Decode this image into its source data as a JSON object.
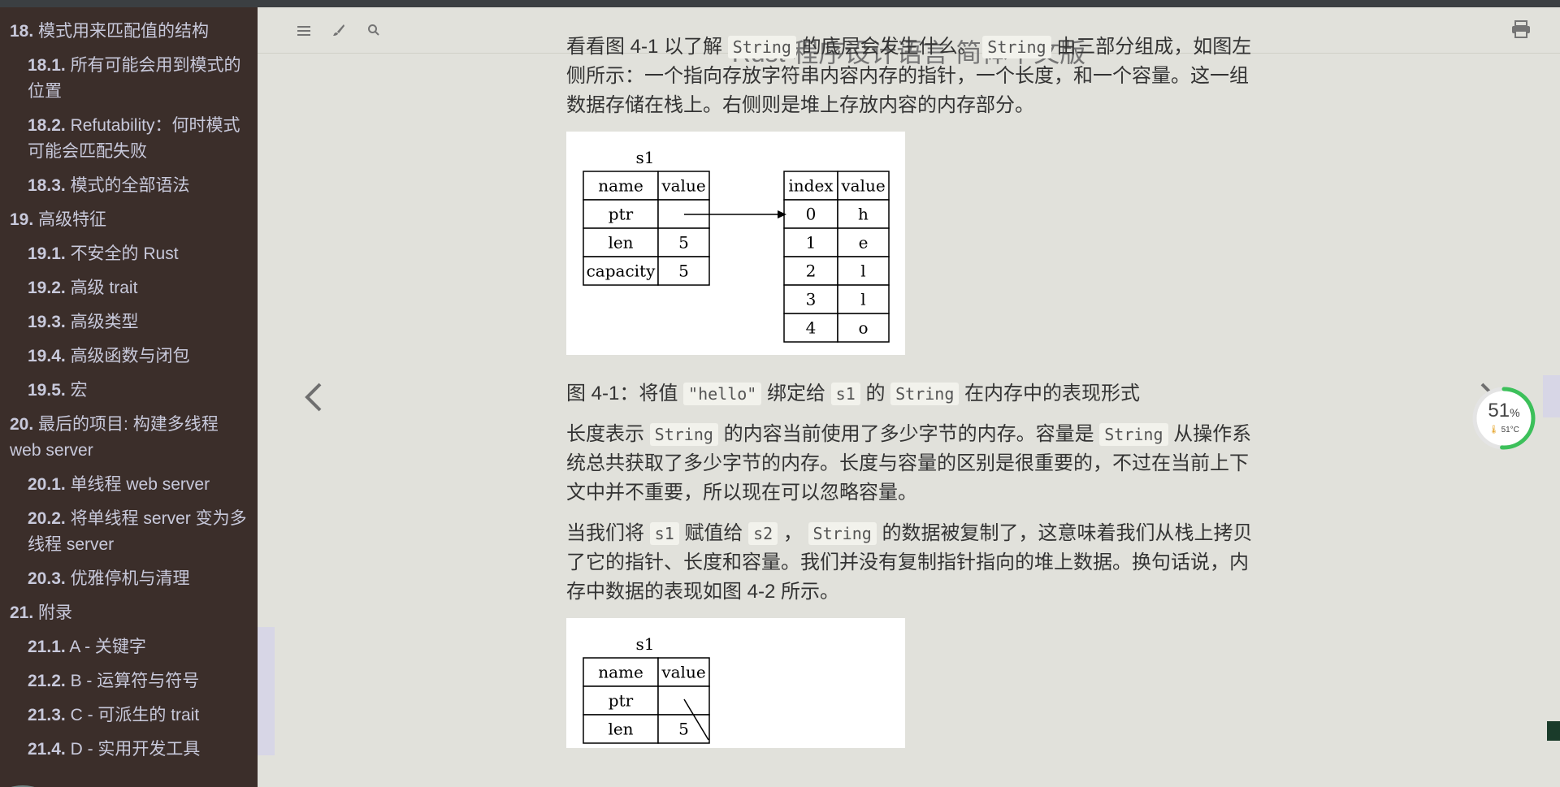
{
  "app": {
    "title": "Rust 程序设计语言 简体中文版"
  },
  "sidebar": {
    "items": [
      {
        "num": "18.",
        "label": "模式用来匹配值的结构",
        "sub": false
      },
      {
        "num": "18.1.",
        "label": "所有可能会用到模式的位置",
        "sub": true
      },
      {
        "num": "18.2.",
        "label": "Refutability：何时模式可能会匹配失败",
        "sub": true
      },
      {
        "num": "18.3.",
        "label": "模式的全部语法",
        "sub": true
      },
      {
        "num": "19.",
        "label": "高级特征",
        "sub": false
      },
      {
        "num": "19.1.",
        "label": "不安全的 Rust",
        "sub": true
      },
      {
        "num": "19.2.",
        "label": "高级 trait",
        "sub": true
      },
      {
        "num": "19.3.",
        "label": "高级类型",
        "sub": true
      },
      {
        "num": "19.4.",
        "label": "高级函数与闭包",
        "sub": true
      },
      {
        "num": "19.5.",
        "label": "宏",
        "sub": true
      },
      {
        "num": "20.",
        "label": "最后的项目: 构建多线程 web server",
        "sub": false
      },
      {
        "num": "20.1.",
        "label": "单线程 web server",
        "sub": true
      },
      {
        "num": "20.2.",
        "label": "将单线程 server 变为多线程 server",
        "sub": true
      },
      {
        "num": "20.3.",
        "label": "优雅停机与清理",
        "sub": true
      },
      {
        "num": "21.",
        "label": "附录",
        "sub": false
      },
      {
        "num": "21.1.",
        "label": "A - 关键字",
        "sub": true
      },
      {
        "num": "21.2.",
        "label": "B - 运算符与符号",
        "sub": true
      },
      {
        "num": "21.3.",
        "label": "C - 可派生的 trait",
        "sub": true
      },
      {
        "num": "21.4.",
        "label": "D - 实用开发工具",
        "sub": true
      }
    ]
  },
  "content": {
    "p0_part1": "看看图 4-1 以了解",
    "p0_code1": "String",
    "p0_part2": "的底层会发生什么。",
    "p0_code2": "String",
    "p0_part3": "由三部分组成，如图左侧所示：一个指向存放字符串内容内存的指针，一个长度，和一个容量。这一组数据存储在栈上。右侧则是堆上存放内容的内存部分。",
    "fig1": {
      "var": "s1",
      "left_headers": [
        "name",
        "value"
      ],
      "left_rows": [
        [
          "ptr",
          ""
        ],
        [
          "len",
          "5"
        ],
        [
          "capacity",
          "5"
        ]
      ],
      "right_headers": [
        "index",
        "value"
      ],
      "right_rows": [
        [
          "0",
          "h"
        ],
        [
          "1",
          "e"
        ],
        [
          "2",
          "l"
        ],
        [
          "3",
          "l"
        ],
        [
          "4",
          "o"
        ]
      ]
    },
    "caption_part1": "图 4-1：将值",
    "caption_code1": "\"hello\"",
    "caption_part2": "绑定给",
    "caption_code2": "s1",
    "caption_part3": "的",
    "caption_code3": "String",
    "caption_part4": "在内存中的表现形式",
    "p1_part1": "长度表示",
    "p1_code1": "String",
    "p1_part2": "的内容当前使用了多少字节的内存。容量是",
    "p1_code2": "String",
    "p1_part3": "从操作系统总共获取了多少字节的内存。长度与容量的区别是很重要的，不过在当前上下文中并不重要，所以现在可以忽略容量。",
    "p2_part1": "当我们将",
    "p2_code1": "s1",
    "p2_part2": "赋值给",
    "p2_code2": "s2",
    "p2_part3": "，",
    "p2_code3": "String",
    "p2_part4": "的数据被复制了，这意味着我们从栈上拷贝了它的指针、长度和容量。我们并没有复制指针指向的堆上数据。换句话说，内存中数据的表现如图 4-2 所示。",
    "fig2": {
      "var": "s1",
      "left_headers": [
        "name",
        "value"
      ],
      "left_rows": [
        [
          "ptr",
          ""
        ],
        [
          "len",
          "5"
        ]
      ]
    }
  },
  "widget": {
    "percent": "51",
    "percent_unit": "%",
    "temp": "51°C",
    "level": 0.51
  },
  "icons": {
    "menu": "hamburger-icon",
    "theme": "paintbrush-icon",
    "search": "search-icon",
    "print": "printer-icon",
    "prev": "chevron-left-icon",
    "next": "chevron-right-icon"
  }
}
